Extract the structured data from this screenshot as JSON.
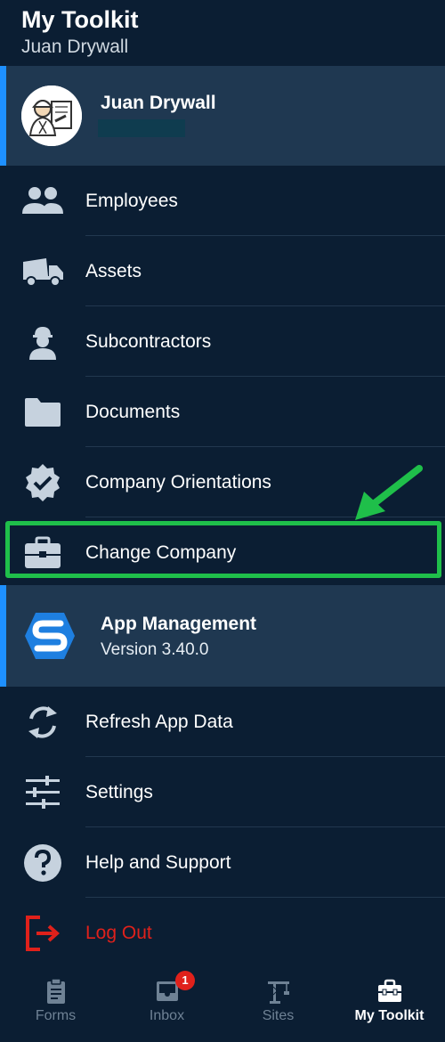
{
  "header": {
    "title": "My Toolkit",
    "subtitle": "Juan Drywall"
  },
  "profile": {
    "name": "Juan Drywall"
  },
  "menu_top": [
    {
      "label": "Employees",
      "icon": "people-icon"
    },
    {
      "label": "Assets",
      "icon": "truck-icon"
    },
    {
      "label": "Subcontractors",
      "icon": "worker-icon"
    },
    {
      "label": "Documents",
      "icon": "folder-icon"
    },
    {
      "label": "Company Orientations",
      "icon": "verified-badge-icon"
    },
    {
      "label": "Change Company",
      "icon": "briefcase-icon"
    }
  ],
  "app": {
    "title": "App Management",
    "version": "Version 3.40.0"
  },
  "menu_bottom": [
    {
      "label": "Refresh App Data",
      "icon": "refresh-icon"
    },
    {
      "label": "Settings",
      "icon": "sliders-icon"
    },
    {
      "label": "Help and Support",
      "icon": "help-icon"
    },
    {
      "label": "Log Out",
      "icon": "logout-icon"
    }
  ],
  "nav": [
    {
      "label": "Forms",
      "icon": "clipboard-icon"
    },
    {
      "label": "Inbox",
      "icon": "inbox-icon",
      "badge": "1"
    },
    {
      "label": "Sites",
      "icon": "crane-icon"
    },
    {
      "label": "My Toolkit",
      "icon": "toolbox-icon",
      "active": true
    }
  ],
  "colors": {
    "background": "#0b1e33",
    "card": "#1f3851",
    "accent": "#1e90ff",
    "highlight": "#1fbf4a",
    "danger": "#e0211b"
  }
}
